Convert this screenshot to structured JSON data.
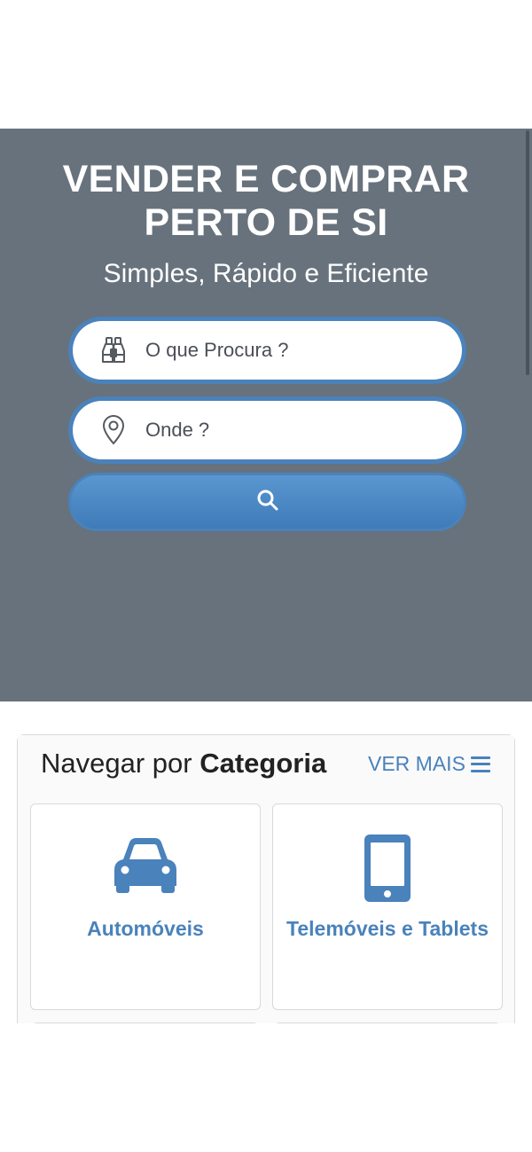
{
  "hero": {
    "title_line1": "VENDER E COMPRAR",
    "title_line2": "PERTO DE SI",
    "subtitle": "Simples, Rápido e Eficiente",
    "background_color": "#67727c"
  },
  "search": {
    "what_placeholder": "O que Procura ?",
    "what_icon": "binoculars-icon",
    "where_placeholder": "Onde ?",
    "where_icon": "location-pin-icon",
    "button_icon": "search-icon",
    "accent_color": "#4a82bb"
  },
  "categories": {
    "heading_prefix": "Navegar por",
    "heading_bold": "Categoria",
    "see_more": "VER MAIS",
    "see_more_icon": "menu-icon",
    "items": [
      {
        "label": "Automóveis",
        "icon": "car-icon"
      },
      {
        "label": "Telemóveis e Tablets",
        "icon": "smartphone-icon"
      }
    ]
  }
}
